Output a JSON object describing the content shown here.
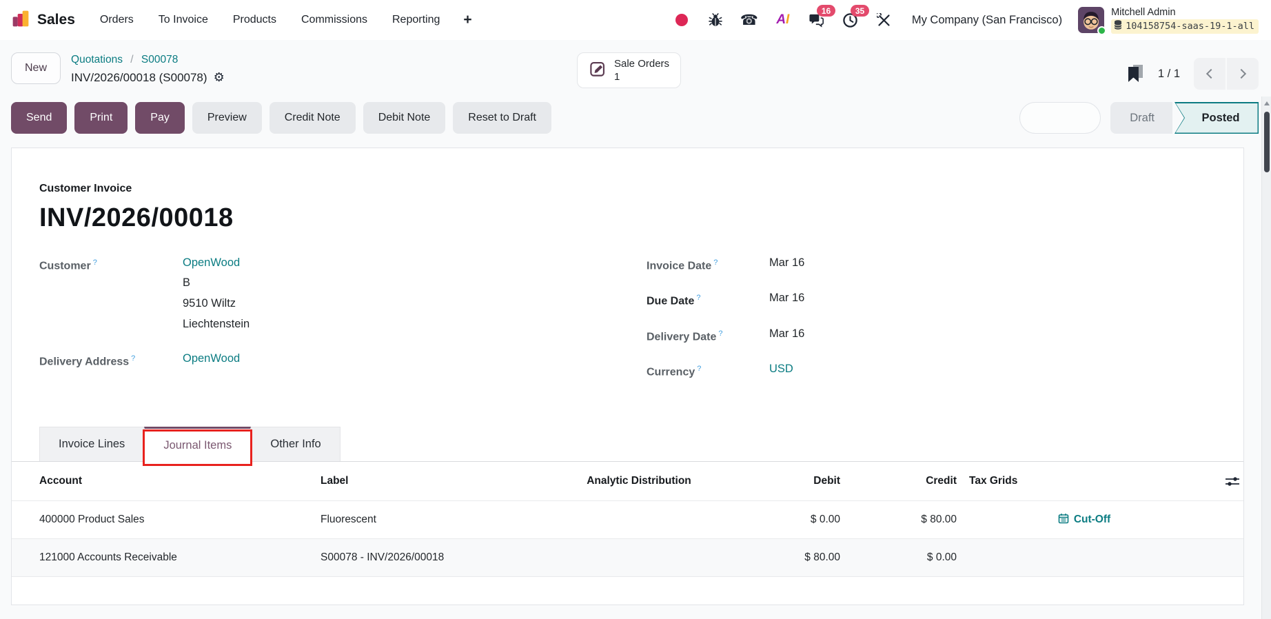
{
  "nav": {
    "app_name": "Sales",
    "menu_items": [
      "Orders",
      "To Invoice",
      "Products",
      "Commissions",
      "Reporting"
    ],
    "plus_label": "+",
    "badges": {
      "chat": "16",
      "activities": "35"
    },
    "company": "My Company (San Francisco)",
    "user_name": "Mitchell Admin",
    "database": "104158754-saas-19-1-all"
  },
  "breadcrumb": {
    "new_button": "New",
    "link1": "Quotations",
    "link2": "S00078",
    "separator": "/",
    "current": "INV/2026/00018 (S00078)",
    "smart_button": {
      "label": "Sale Orders",
      "count": "1"
    },
    "pager_count": "1 / 1"
  },
  "actions": {
    "send": "Send",
    "print": "Print",
    "pay": "Pay",
    "preview": "Preview",
    "credit_note": "Credit Note",
    "debit_note": "Debit Note",
    "reset_to_draft": "Reset to Draft",
    "status_draft": "Draft",
    "status_posted": "Posted",
    "active_status": "Posted"
  },
  "form": {
    "doc_type": "Customer Invoice",
    "doc_number": "INV/2026/00018",
    "help_marker": "?",
    "customer": {
      "label": "Customer",
      "name": "OpenWood",
      "address_lines": [
        "B",
        "9510 Wiltz",
        "Liechtenstein"
      ]
    },
    "delivery_address": {
      "label": "Delivery Address",
      "value": "OpenWood"
    },
    "invoice_date": {
      "label": "Invoice Date",
      "value": "Mar 16"
    },
    "due_date": {
      "label": "Due Date",
      "value": "Mar 16"
    },
    "delivery_date": {
      "label": "Delivery Date",
      "value": "Mar 16"
    },
    "currency": {
      "label": "Currency",
      "value": "USD"
    },
    "tabs": [
      {
        "label": "Invoice Lines"
      },
      {
        "label": "Journal Items"
      },
      {
        "label": "Other Info"
      }
    ],
    "active_tab": "Journal Items"
  },
  "table": {
    "columns": [
      "Account",
      "Label",
      "Analytic Distribution",
      "Debit",
      "Credit",
      "Tax Grids"
    ],
    "rows": [
      {
        "account": "400000 Product Sales",
        "label": "Fluorescent",
        "analytic": "",
        "debit": "$ 0.00",
        "credit": "$ 80.00",
        "tax_grids": "Cut-Off"
      },
      {
        "account": "121000 Accounts Receivable",
        "label": "S00078 - INV/2026/00018",
        "analytic": "",
        "debit": "$ 80.00",
        "credit": "$ 0.00",
        "tax_grids": ""
      }
    ]
  },
  "colors": {
    "primary_purple": "#714B67",
    "link_teal": "#0b7c82",
    "annotation_red": "#e8221e",
    "badge_pink": "#e34a6c",
    "db_highlight_yellow": "#fcf3cf",
    "posted_bg": "#e3f1f1"
  }
}
